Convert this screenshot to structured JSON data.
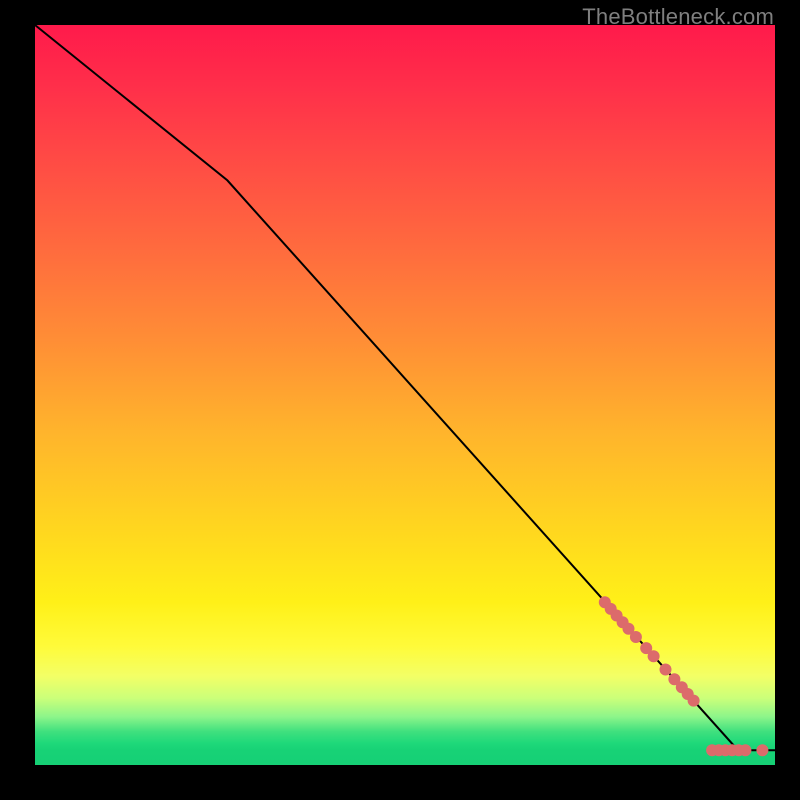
{
  "watermark": "TheBottleneck.com",
  "chart_data": {
    "type": "line",
    "title": "",
    "xlabel": "",
    "ylabel": "",
    "xlim": [
      0,
      100
    ],
    "ylim": [
      0,
      100
    ],
    "grid": false,
    "series": [
      {
        "name": "curve",
        "x": [
          0,
          26,
          95,
          100
        ],
        "y": [
          100,
          79,
          2,
          2
        ],
        "stroke": "#000000",
        "width": 2
      }
    ],
    "markers": [
      {
        "name": "cluster-upper",
        "color": "#dc6b6b",
        "radius": 6,
        "points": [
          {
            "x": 77.0,
            "y": 22.0
          },
          {
            "x": 77.8,
            "y": 21.1
          },
          {
            "x": 78.6,
            "y": 20.2
          },
          {
            "x": 79.4,
            "y": 19.3
          },
          {
            "x": 80.2,
            "y": 18.4
          },
          {
            "x": 81.2,
            "y": 17.3
          },
          {
            "x": 82.6,
            "y": 15.8
          },
          {
            "x": 83.6,
            "y": 14.7
          },
          {
            "x": 85.2,
            "y": 12.9
          },
          {
            "x": 86.4,
            "y": 11.6
          },
          {
            "x": 87.4,
            "y": 10.5
          },
          {
            "x": 88.2,
            "y": 9.6
          },
          {
            "x": 89.0,
            "y": 8.7
          }
        ]
      },
      {
        "name": "cluster-lower",
        "color": "#dc6b6b",
        "radius": 6,
        "points": [
          {
            "x": 91.5,
            "y": 2.0
          },
          {
            "x": 92.4,
            "y": 2.0
          },
          {
            "x": 93.3,
            "y": 2.0
          },
          {
            "x": 94.2,
            "y": 2.0
          },
          {
            "x": 95.1,
            "y": 2.0
          },
          {
            "x": 96.0,
            "y": 2.0
          },
          {
            "x": 98.3,
            "y": 2.0
          }
        ]
      }
    ]
  }
}
